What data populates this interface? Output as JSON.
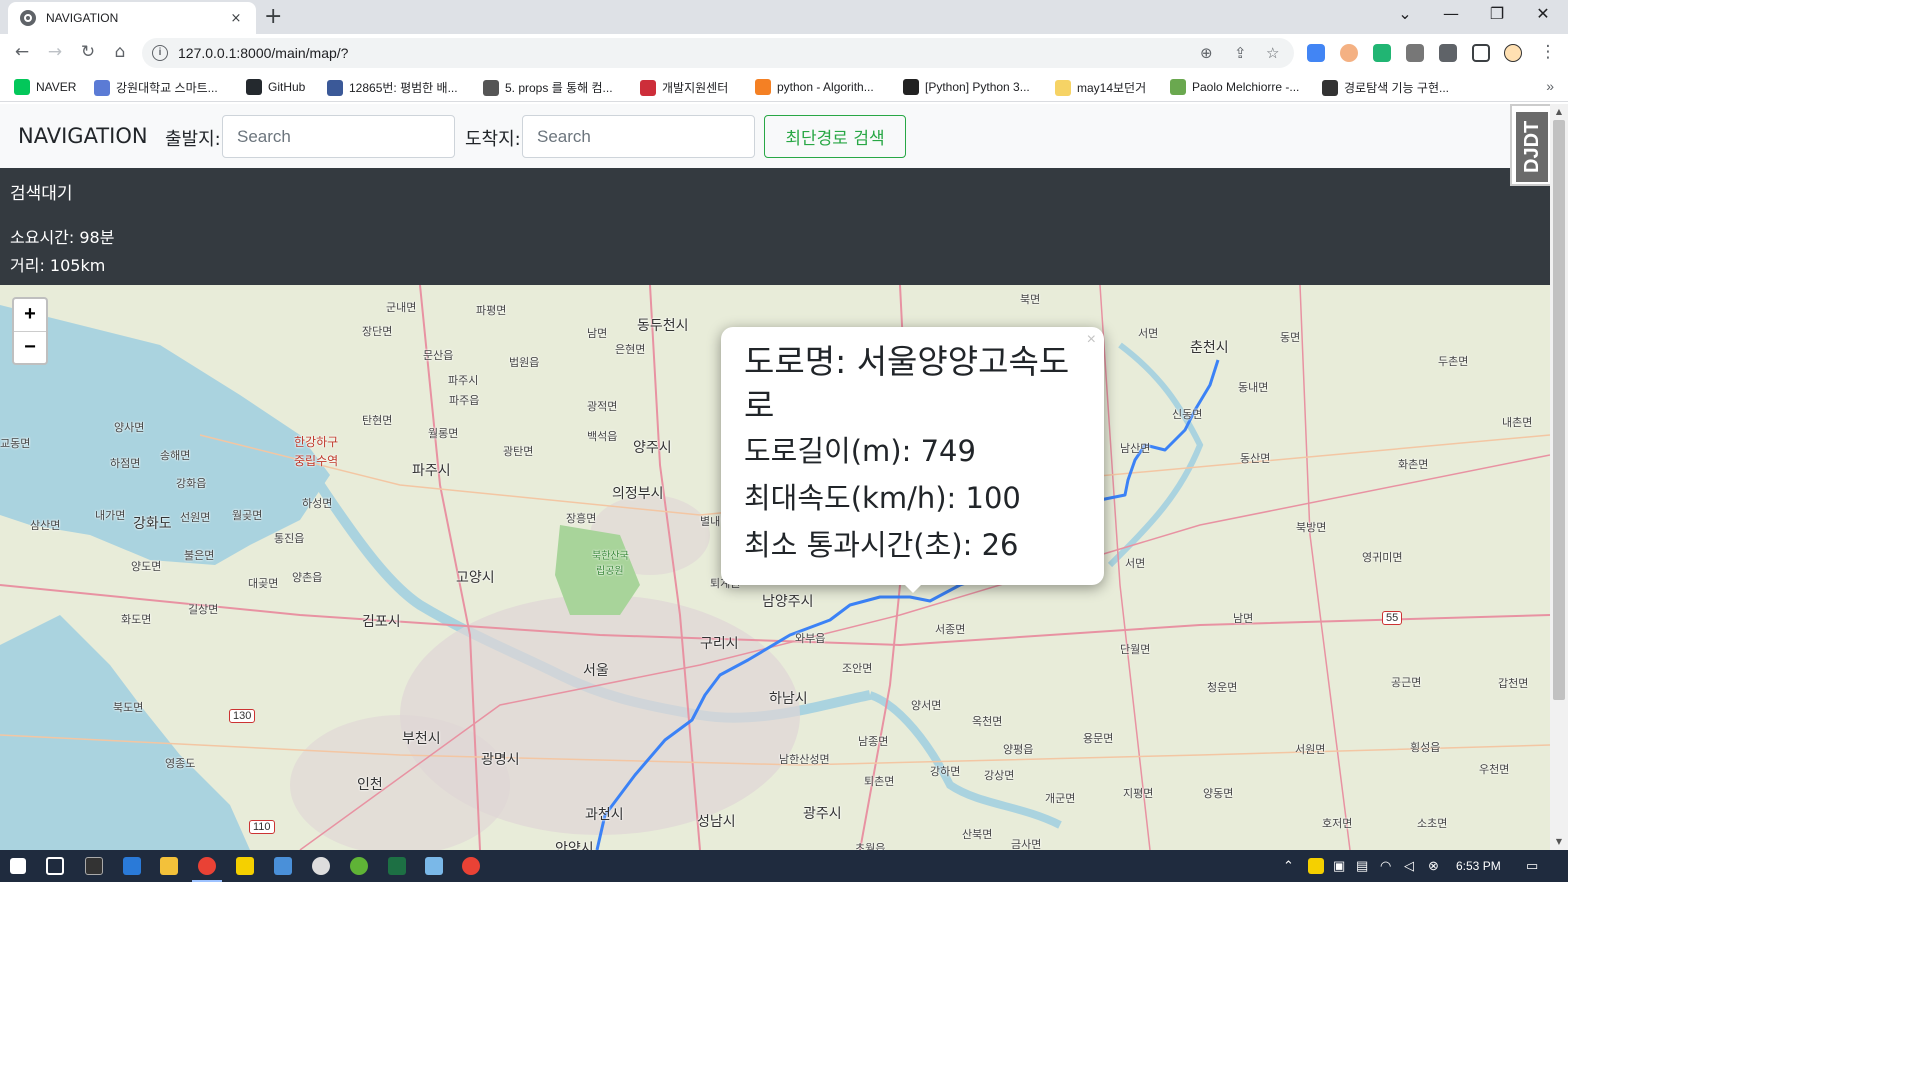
{
  "browser": {
    "tab_title": "NAVIGATION",
    "tab_close": "×",
    "new_tab": "+",
    "url": "127.0.0.1:8000/main/map/?",
    "omni_info": "i"
  },
  "bookmarks": [
    {
      "label": "NAVER",
      "icon": "naver-icon",
      "color": "#03c75a"
    },
    {
      "label": "강원대학교 스마트...",
      "icon": "globe-icon",
      "color": "#5b7bd5"
    },
    {
      "label": "GitHub",
      "icon": "github-icon",
      "color": "#24292e"
    },
    {
      "label": "12865번: 평범한 배...",
      "icon": "code-icon",
      "color": "#3b5998"
    },
    {
      "label": "5. props 를 통해 컴...",
      "icon": "book-icon",
      "color": "#555555"
    },
    {
      "label": "개발지원센터",
      "icon": "taegeuk-icon",
      "color": "#cd2e3a"
    },
    {
      "label": "python - Algorith...",
      "icon": "stackoverflow-icon",
      "color": "#f48024"
    },
    {
      "label": "[Python] Python 3...",
      "icon": "velog-icon",
      "color": "#222222"
    },
    {
      "label": "may14보던거",
      "icon": "folder-icon",
      "color": "#f6d365"
    },
    {
      "label": "Paolo Melchiorre -...",
      "icon": "python-icon",
      "color": "#6aa84f"
    },
    {
      "label": "경로탐색 기능 구현...",
      "icon": "robot-icon",
      "color": "#333333"
    }
  ],
  "bookmarks_more": "»",
  "navbar": {
    "brand": "NAVIGATION",
    "start_label": "출발지:",
    "start_placeholder": "Search",
    "end_label": "도착지:",
    "end_placeholder": "Search",
    "route_button": "최단경로 검색"
  },
  "status": {
    "title": "검색대기",
    "duration": "소요시간: 98분",
    "distance": "거리: 105km"
  },
  "map": {
    "zoom_in": "+",
    "zoom_out": "−",
    "route_color": "#3b82f6",
    "labels": [
      {
        "text": "군내면",
        "cls": ""
      },
      {
        "text": "파평면",
        "cls": ""
      },
      {
        "text": "장단면",
        "cls": ""
      },
      {
        "text": "남면",
        "cls": ""
      },
      {
        "text": "동두천시",
        "cls": "city"
      },
      {
        "text": "문산읍",
        "cls": ""
      },
      {
        "text": "은현면",
        "cls": ""
      },
      {
        "text": "법원읍",
        "cls": ""
      },
      {
        "text": "파주시",
        "cls": ""
      },
      {
        "text": "파주읍",
        "cls": ""
      },
      {
        "text": "광적면",
        "cls": ""
      },
      {
        "text": "탄현면",
        "cls": ""
      },
      {
        "text": "월롱면",
        "cls": ""
      },
      {
        "text": "백석읍",
        "cls": ""
      },
      {
        "text": "양주시",
        "cls": "city"
      },
      {
        "text": "한강하구",
        "cls": "red"
      },
      {
        "text": "중립수역",
        "cls": "red"
      },
      {
        "text": "광탄면",
        "cls": ""
      },
      {
        "text": "파주시",
        "cls": "city"
      },
      {
        "text": "의정부시",
        "cls": "city"
      },
      {
        "text": "교동면",
        "cls": ""
      },
      {
        "text": "양사면",
        "cls": ""
      },
      {
        "text": "송해면",
        "cls": ""
      },
      {
        "text": "하점면",
        "cls": ""
      },
      {
        "text": "강화읍",
        "cls": ""
      },
      {
        "text": "하성면",
        "cls": ""
      },
      {
        "text": "내가면",
        "cls": ""
      },
      {
        "text": "강화도",
        "cls": "city"
      },
      {
        "text": "선원면",
        "cls": ""
      },
      {
        "text": "월곶면",
        "cls": ""
      },
      {
        "text": "장흥면",
        "cls": ""
      },
      {
        "text": "삼산면",
        "cls": ""
      },
      {
        "text": "통진읍",
        "cls": ""
      },
      {
        "text": "불은면",
        "cls": ""
      },
      {
        "text": "북한산국",
        "cls": "green"
      },
      {
        "text": "립공원",
        "cls": "green"
      },
      {
        "text": "양도면",
        "cls": ""
      },
      {
        "text": "양촌읍",
        "cls": ""
      },
      {
        "text": "고양시",
        "cls": "city"
      },
      {
        "text": "대곶면",
        "cls": ""
      },
      {
        "text": "화도면",
        "cls": ""
      },
      {
        "text": "길상면",
        "cls": ""
      },
      {
        "text": "김포시",
        "cls": "city"
      },
      {
        "text": "남양주시",
        "cls": "city"
      },
      {
        "text": "구리시",
        "cls": "city"
      },
      {
        "text": "서울",
        "cls": "city"
      },
      {
        "text": "북도면",
        "cls": ""
      },
      {
        "text": "하남시",
        "cls": "city"
      },
      {
        "text": "부천시",
        "cls": "city"
      },
      {
        "text": "영종도",
        "cls": ""
      },
      {
        "text": "광명시",
        "cls": "city"
      },
      {
        "text": "인천",
        "cls": "city"
      },
      {
        "text": "과천시",
        "cls": "city"
      },
      {
        "text": "성남시",
        "cls": "city"
      },
      {
        "text": "북면",
        "cls": ""
      },
      {
        "text": "서면",
        "cls": ""
      },
      {
        "text": "춘천시",
        "cls": "city"
      },
      {
        "text": "동면",
        "cls": ""
      },
      {
        "text": "두촌면",
        "cls": ""
      },
      {
        "text": "동내면",
        "cls": ""
      },
      {
        "text": "신동면",
        "cls": ""
      },
      {
        "text": "내촌면",
        "cls": ""
      },
      {
        "text": "남산면",
        "cls": ""
      },
      {
        "text": "동산면",
        "cls": ""
      },
      {
        "text": "화촌면",
        "cls": ""
      },
      {
        "text": "북방면",
        "cls": ""
      },
      {
        "text": "서면",
        "cls": ""
      },
      {
        "text": "영귀미면",
        "cls": ""
      },
      {
        "text": "남면",
        "cls": ""
      },
      {
        "text": "서종면",
        "cls": ""
      },
      {
        "text": "단월면",
        "cls": ""
      },
      {
        "text": "조안면",
        "cls": ""
      },
      {
        "text": "청운면",
        "cls": ""
      },
      {
        "text": "공근면",
        "cls": ""
      },
      {
        "text": "갑천면",
        "cls": ""
      },
      {
        "text": "양서면",
        "cls": ""
      },
      {
        "text": "옥천면",
        "cls": ""
      },
      {
        "text": "용문면",
        "cls": ""
      },
      {
        "text": "남종면",
        "cls": ""
      },
      {
        "text": "양평읍",
        "cls": ""
      },
      {
        "text": "서원면",
        "cls": ""
      },
      {
        "text": "횡성읍",
        "cls": ""
      },
      {
        "text": "우천면",
        "cls": ""
      },
      {
        "text": "남한산성면",
        "cls": ""
      },
      {
        "text": "퇴촌면",
        "cls": ""
      },
      {
        "text": "강하면",
        "cls": ""
      },
      {
        "text": "강상면",
        "cls": ""
      },
      {
        "text": "개군면",
        "cls": ""
      },
      {
        "text": "지평면",
        "cls": ""
      },
      {
        "text": "양동면",
        "cls": ""
      },
      {
        "text": "광주시",
        "cls": "city"
      },
      {
        "text": "호저면",
        "cls": ""
      },
      {
        "text": "소초면",
        "cls": ""
      },
      {
        "text": "산북면",
        "cls": ""
      },
      {
        "text": "금사면",
        "cls": ""
      },
      {
        "text": "안양시",
        "cls": "city"
      },
      {
        "text": "별내면",
        "cls": ""
      },
      {
        "text": "퇴계원",
        "cls": ""
      },
      {
        "text": "와부읍",
        "cls": ""
      },
      {
        "text": "초월읍",
        "cls": ""
      }
    ],
    "shields": [
      "130",
      "110",
      "55"
    ]
  },
  "popup": {
    "close": "×",
    "road_name": "도로명: 서울양양고속도로",
    "length": "도로길이(m): 749",
    "max_speed": "최대속도(km/h): 100",
    "min_time": "최소 통과시간(초): 26"
  },
  "djdt": "DJDT",
  "taskbar": {
    "clock": "6:53 PM"
  }
}
